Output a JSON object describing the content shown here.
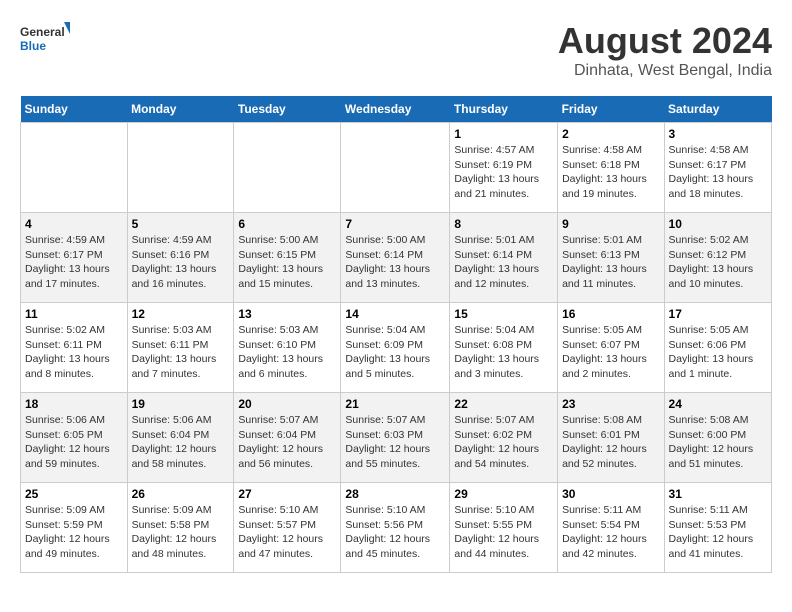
{
  "header": {
    "logo_general": "General",
    "logo_blue": "Blue",
    "month_year": "August 2024",
    "location": "Dinhata, West Bengal, India"
  },
  "days_of_week": [
    "Sunday",
    "Monday",
    "Tuesday",
    "Wednesday",
    "Thursday",
    "Friday",
    "Saturday"
  ],
  "weeks": [
    [
      {
        "day": "",
        "info": ""
      },
      {
        "day": "",
        "info": ""
      },
      {
        "day": "",
        "info": ""
      },
      {
        "day": "",
        "info": ""
      },
      {
        "day": "1",
        "info": "Sunrise: 4:57 AM\nSunset: 6:19 PM\nDaylight: 13 hours\nand 21 minutes."
      },
      {
        "day": "2",
        "info": "Sunrise: 4:58 AM\nSunset: 6:18 PM\nDaylight: 13 hours\nand 19 minutes."
      },
      {
        "day": "3",
        "info": "Sunrise: 4:58 AM\nSunset: 6:17 PM\nDaylight: 13 hours\nand 18 minutes."
      }
    ],
    [
      {
        "day": "4",
        "info": "Sunrise: 4:59 AM\nSunset: 6:17 PM\nDaylight: 13 hours\nand 17 minutes."
      },
      {
        "day": "5",
        "info": "Sunrise: 4:59 AM\nSunset: 6:16 PM\nDaylight: 13 hours\nand 16 minutes."
      },
      {
        "day": "6",
        "info": "Sunrise: 5:00 AM\nSunset: 6:15 PM\nDaylight: 13 hours\nand 15 minutes."
      },
      {
        "day": "7",
        "info": "Sunrise: 5:00 AM\nSunset: 6:14 PM\nDaylight: 13 hours\nand 13 minutes."
      },
      {
        "day": "8",
        "info": "Sunrise: 5:01 AM\nSunset: 6:14 PM\nDaylight: 13 hours\nand 12 minutes."
      },
      {
        "day": "9",
        "info": "Sunrise: 5:01 AM\nSunset: 6:13 PM\nDaylight: 13 hours\nand 11 minutes."
      },
      {
        "day": "10",
        "info": "Sunrise: 5:02 AM\nSunset: 6:12 PM\nDaylight: 13 hours\nand 10 minutes."
      }
    ],
    [
      {
        "day": "11",
        "info": "Sunrise: 5:02 AM\nSunset: 6:11 PM\nDaylight: 13 hours\nand 8 minutes."
      },
      {
        "day": "12",
        "info": "Sunrise: 5:03 AM\nSunset: 6:11 PM\nDaylight: 13 hours\nand 7 minutes."
      },
      {
        "day": "13",
        "info": "Sunrise: 5:03 AM\nSunset: 6:10 PM\nDaylight: 13 hours\nand 6 minutes."
      },
      {
        "day": "14",
        "info": "Sunrise: 5:04 AM\nSunset: 6:09 PM\nDaylight: 13 hours\nand 5 minutes."
      },
      {
        "day": "15",
        "info": "Sunrise: 5:04 AM\nSunset: 6:08 PM\nDaylight: 13 hours\nand 3 minutes."
      },
      {
        "day": "16",
        "info": "Sunrise: 5:05 AM\nSunset: 6:07 PM\nDaylight: 13 hours\nand 2 minutes."
      },
      {
        "day": "17",
        "info": "Sunrise: 5:05 AM\nSunset: 6:06 PM\nDaylight: 13 hours\nand 1 minute."
      }
    ],
    [
      {
        "day": "18",
        "info": "Sunrise: 5:06 AM\nSunset: 6:05 PM\nDaylight: 12 hours\nand 59 minutes."
      },
      {
        "day": "19",
        "info": "Sunrise: 5:06 AM\nSunset: 6:04 PM\nDaylight: 12 hours\nand 58 minutes."
      },
      {
        "day": "20",
        "info": "Sunrise: 5:07 AM\nSunset: 6:04 PM\nDaylight: 12 hours\nand 56 minutes."
      },
      {
        "day": "21",
        "info": "Sunrise: 5:07 AM\nSunset: 6:03 PM\nDaylight: 12 hours\nand 55 minutes."
      },
      {
        "day": "22",
        "info": "Sunrise: 5:07 AM\nSunset: 6:02 PM\nDaylight: 12 hours\nand 54 minutes."
      },
      {
        "day": "23",
        "info": "Sunrise: 5:08 AM\nSunset: 6:01 PM\nDaylight: 12 hours\nand 52 minutes."
      },
      {
        "day": "24",
        "info": "Sunrise: 5:08 AM\nSunset: 6:00 PM\nDaylight: 12 hours\nand 51 minutes."
      }
    ],
    [
      {
        "day": "25",
        "info": "Sunrise: 5:09 AM\nSunset: 5:59 PM\nDaylight: 12 hours\nand 49 minutes."
      },
      {
        "day": "26",
        "info": "Sunrise: 5:09 AM\nSunset: 5:58 PM\nDaylight: 12 hours\nand 48 minutes."
      },
      {
        "day": "27",
        "info": "Sunrise: 5:10 AM\nSunset: 5:57 PM\nDaylight: 12 hours\nand 47 minutes."
      },
      {
        "day": "28",
        "info": "Sunrise: 5:10 AM\nSunset: 5:56 PM\nDaylight: 12 hours\nand 45 minutes."
      },
      {
        "day": "29",
        "info": "Sunrise: 5:10 AM\nSunset: 5:55 PM\nDaylight: 12 hours\nand 44 minutes."
      },
      {
        "day": "30",
        "info": "Sunrise: 5:11 AM\nSunset: 5:54 PM\nDaylight: 12 hours\nand 42 minutes."
      },
      {
        "day": "31",
        "info": "Sunrise: 5:11 AM\nSunset: 5:53 PM\nDaylight: 12 hours\nand 41 minutes."
      }
    ]
  ]
}
